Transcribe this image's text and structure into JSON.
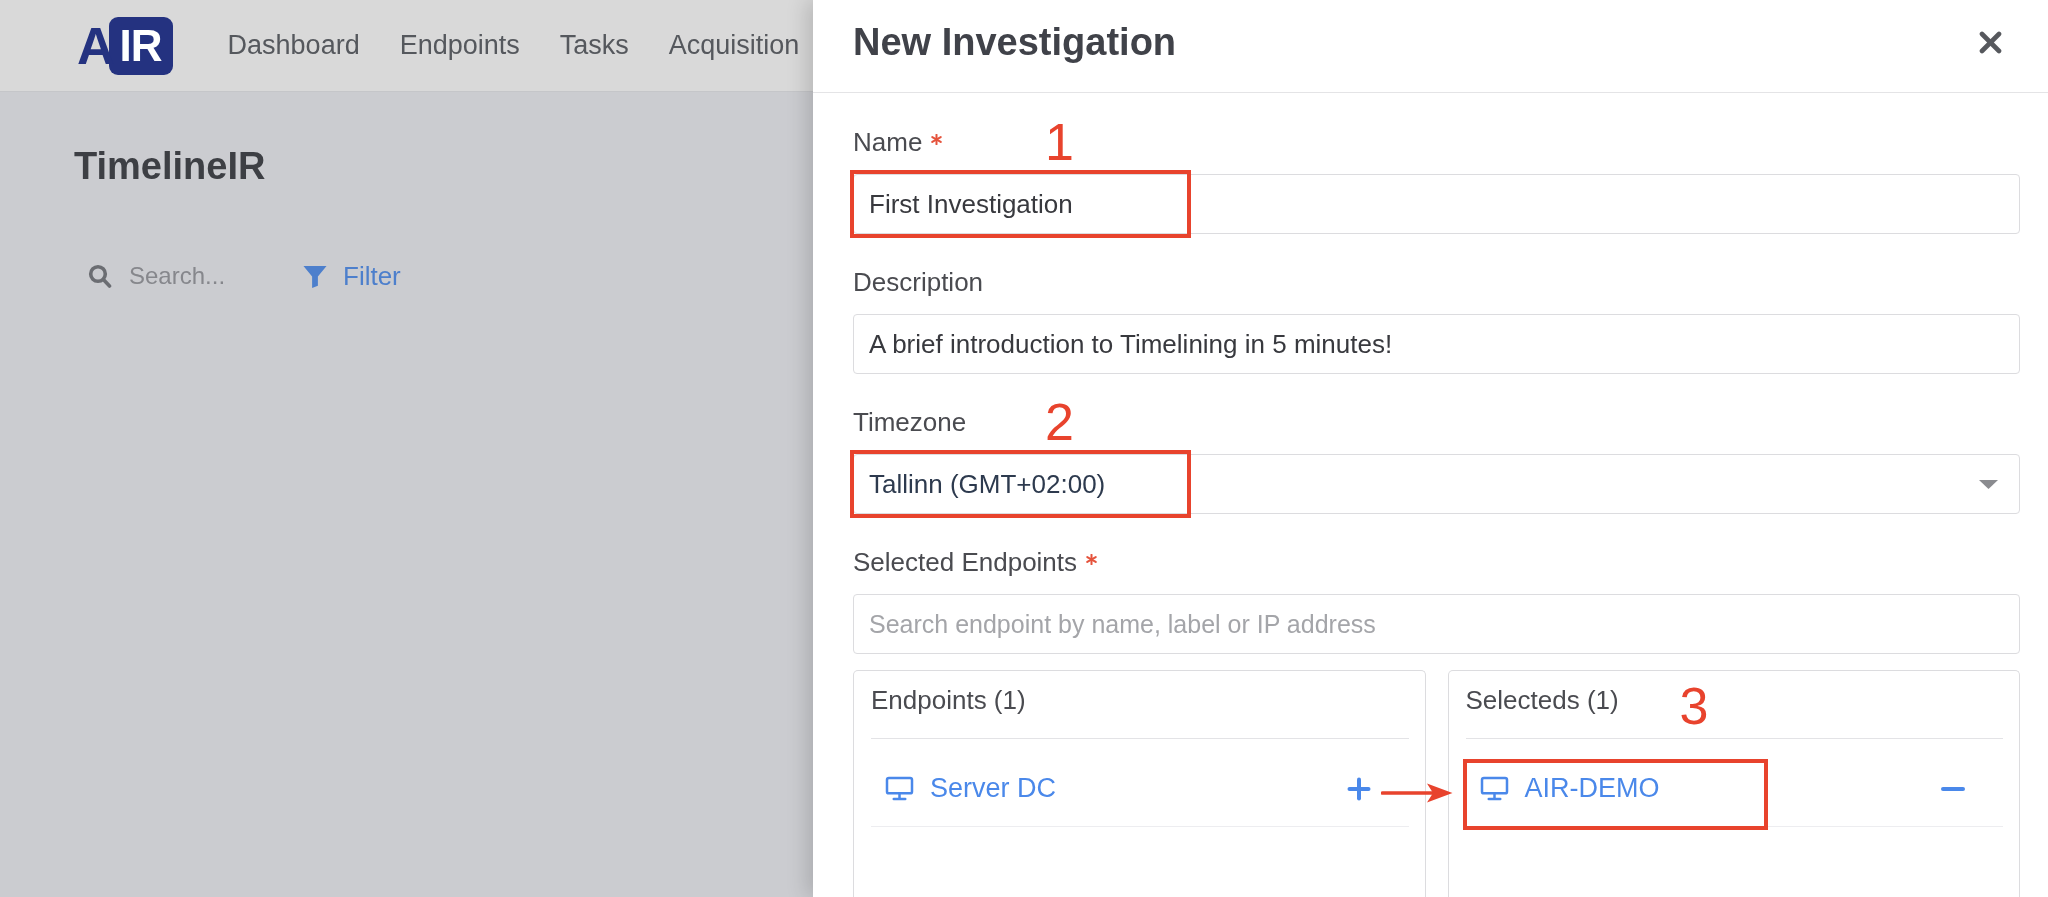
{
  "app": {
    "logo": {
      "mark": "A",
      "badge": "IR"
    },
    "nav": [
      {
        "label": "Dashboard"
      },
      {
        "label": "Endpoints"
      },
      {
        "label": "Tasks"
      },
      {
        "label": "Acquisition"
      }
    ],
    "page_title": "TimelineIR",
    "search": {
      "placeholder": "Search..."
    },
    "filter_button": "Filter"
  },
  "modal": {
    "title": "New Investigation",
    "fields": [
      {
        "kind": "text",
        "label": "Name",
        "required": true,
        "value": "First Investigation",
        "annotation": "1"
      },
      {
        "kind": "text",
        "label": "Description",
        "required": false,
        "value": "A brief introduction to Timelining in 5 minutes!"
      },
      {
        "kind": "select",
        "label": "Timezone",
        "required": false,
        "value": "Tallinn (GMT+02:00)",
        "annotation": "2"
      },
      {
        "kind": "search",
        "label": "Selected Endpoints",
        "required": true,
        "placeholder": "Search endpoint by name, label or IP address"
      }
    ],
    "panels": [
      {
        "title": "Endpoints (1)",
        "items": [
          {
            "name": "Server DC",
            "kind": "add"
          }
        ]
      },
      {
        "title": "Selecteds (1)",
        "items": [
          {
            "name": "AIR-DEMO",
            "kind": "remove",
            "annotation": "3"
          }
        ]
      }
    ]
  }
}
